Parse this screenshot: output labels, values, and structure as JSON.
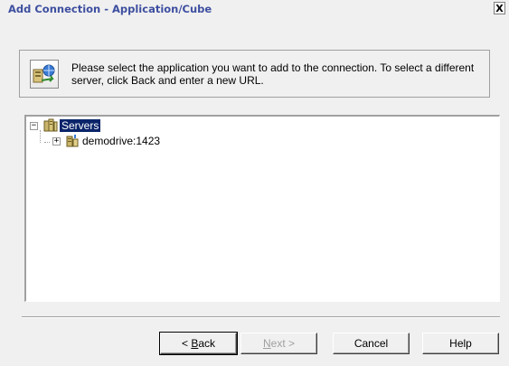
{
  "window": {
    "title": "Add Connection - Application/Cube",
    "close_glyph": "X"
  },
  "instructions": {
    "icon": "server-connection-icon",
    "text": "Please select the application you want to add to the connection.  To select a different server, click Back and enter a new URL."
  },
  "tree": {
    "root": {
      "label": "Servers",
      "expanded": true,
      "selected": true,
      "expander": "−",
      "icon": "servers-icon"
    },
    "children": [
      {
        "label": "demodrive:1423",
        "expanded": false,
        "expander": "+",
        "icon": "server-icon"
      }
    ]
  },
  "buttons": {
    "back": {
      "prefix": "< ",
      "accel": "B",
      "rest": "ack"
    },
    "next": {
      "accel": "N",
      "rest": "ext >",
      "disabled": true
    },
    "cancel": "Cancel",
    "help": "Help"
  }
}
